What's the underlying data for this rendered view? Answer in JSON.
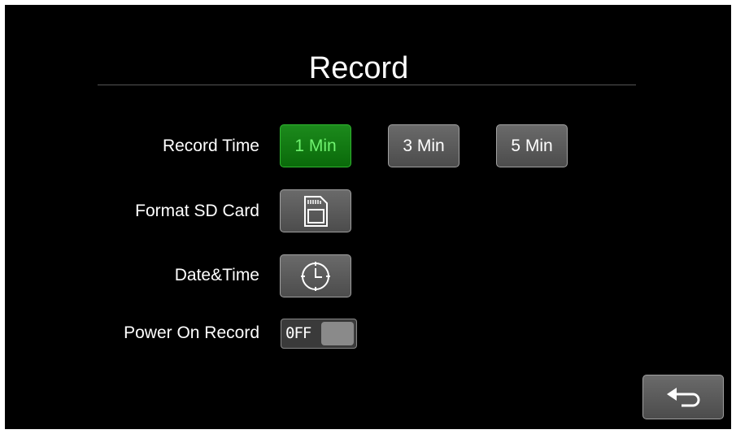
{
  "page": {
    "title": "Record"
  },
  "settings": {
    "record_time": {
      "label": "Record Time",
      "options": [
        "1 Min",
        "3 Min",
        "5 Min"
      ],
      "selected": "1 Min"
    },
    "format_sd": {
      "label": "Format SD Card",
      "icon": "sd-card-icon"
    },
    "date_time": {
      "label": "Date&Time",
      "icon": "clock-icon"
    },
    "power_on_record": {
      "label": "Power On Record",
      "state": "0FF"
    }
  },
  "navigation": {
    "back_icon": "back-arrow-icon"
  },
  "colors": {
    "background": "#000000",
    "selected_bg": "#0f7a0f",
    "selected_text": "#6ff26f",
    "button_bg": "#555555"
  }
}
